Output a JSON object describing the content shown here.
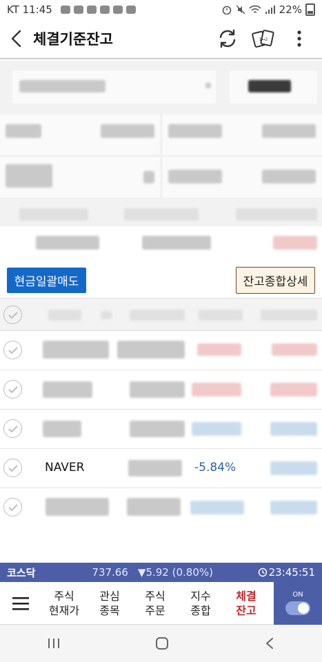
{
  "status": {
    "carrier_time": "KT 11:45",
    "battery": "22%"
  },
  "header": {
    "title": "체결기준잔고"
  },
  "buttons": {
    "sell_all": "현금일괄매도",
    "detail": "잔고종합상세"
  },
  "rows": [
    {
      "name": "",
      "rate": ""
    },
    {
      "name": "",
      "rate": ""
    },
    {
      "name": "",
      "rate": ""
    },
    {
      "name": "NAVER",
      "rate": "-5.84%"
    },
    {
      "name": "",
      "rate": ""
    }
  ],
  "ticker": {
    "name": "코스닥",
    "value": "737.66",
    "change": "▼5.92 (0.80%)",
    "time": "23:45:51"
  },
  "nav": {
    "items": [
      {
        "line1": "주식",
        "line2": "현재가"
      },
      {
        "line1": "관심",
        "line2": "종목"
      },
      {
        "line1": "주식",
        "line2": "주문"
      },
      {
        "line1": "지수",
        "line2": "종합"
      },
      {
        "line1": "체결",
        "line2": "잔고"
      }
    ],
    "toggle_label": "ON"
  },
  "colors": {
    "accent_blue": "#1468c8",
    "ticker_bg": "#4b5ea6",
    "active_red": "#c0262c",
    "rate_blue": "#2a5ea8"
  }
}
